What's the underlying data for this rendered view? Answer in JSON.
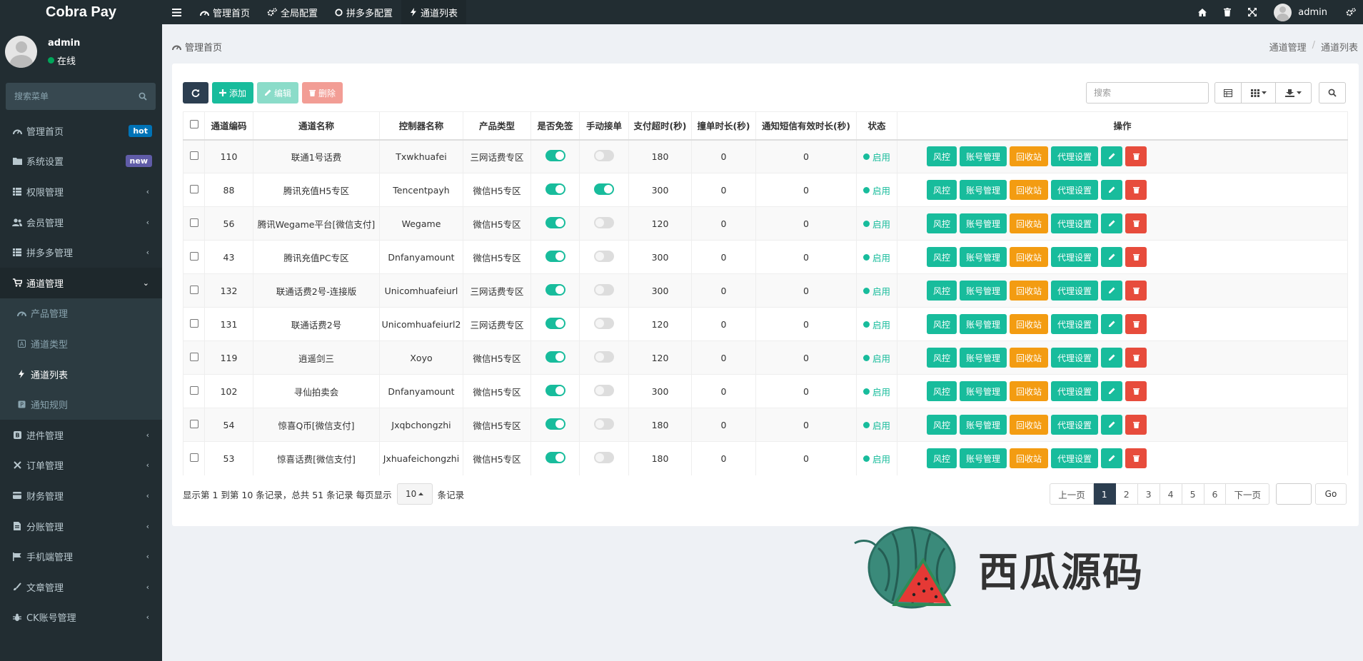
{
  "app": {
    "brand": "Cobra Pay"
  },
  "user": {
    "name": "admin",
    "status": "在线"
  },
  "sidebar": {
    "search_placeholder": "搜索菜单",
    "items": [
      {
        "label": "管理首页",
        "badge": "hot",
        "badge_color": "#0073b7"
      },
      {
        "label": "系统设置",
        "badge": "new",
        "badge_color": "#605ca8"
      },
      {
        "label": "权限管理"
      },
      {
        "label": "会员管理"
      },
      {
        "label": "拼多多管理"
      },
      {
        "label": "通道管理"
      }
    ],
    "sub_items": [
      {
        "label": "产品管理"
      },
      {
        "label": "通道类型"
      },
      {
        "label": "通道列表"
      },
      {
        "label": "通知规则"
      }
    ],
    "items_after": [
      {
        "label": "进件管理"
      },
      {
        "label": "订单管理"
      },
      {
        "label": "财务管理"
      },
      {
        "label": "分账管理"
      },
      {
        "label": "手机端管理"
      },
      {
        "label": "文章管理"
      },
      {
        "label": "CK账号管理"
      }
    ]
  },
  "topnav": {
    "tabs": [
      {
        "label": "管理首页"
      },
      {
        "label": "全局配置"
      },
      {
        "label": "拼多多配置"
      },
      {
        "label": "通道列表"
      }
    ],
    "right_user": "admin"
  },
  "content": {
    "title": "管理首页",
    "breadcrumb": [
      "通道管理",
      "通道列表"
    ]
  },
  "toolbar": {
    "add": "添加",
    "edit": "编辑",
    "delete": "删除",
    "search_placeholder": "搜索"
  },
  "table": {
    "columns": [
      "通道编码",
      "通道名称",
      "控制器名称",
      "产品类型",
      "是否免签",
      "手动接单",
      "支付超时(秒)",
      "撞单时长(秒)",
      "通知短信有效时长(秒)",
      "状态",
      "操作"
    ],
    "rows": [
      {
        "code": "110",
        "name": "联通1号话费",
        "controller": "Txwkhuafei",
        "product": "三网话费专区",
        "free_sign": true,
        "manual": false,
        "timeout": "180",
        "collide": "0",
        "sms": "0",
        "status": "启用"
      },
      {
        "code": "88",
        "name": "腾讯充值H5专区",
        "controller": "Tencentpayh",
        "product": "微信H5专区",
        "free_sign": true,
        "manual": true,
        "timeout": "300",
        "collide": "0",
        "sms": "0",
        "status": "启用"
      },
      {
        "code": "56",
        "name": "腾讯Wegame平台[微信支付]",
        "controller": "Wegame",
        "product": "微信H5专区",
        "free_sign": true,
        "manual": false,
        "timeout": "120",
        "collide": "0",
        "sms": "0",
        "status": "启用"
      },
      {
        "code": "43",
        "name": "腾讯充值PC专区",
        "controller": "Dnfanyamount",
        "product": "微信H5专区",
        "free_sign": true,
        "manual": false,
        "timeout": "300",
        "collide": "0",
        "sms": "0",
        "status": "启用"
      },
      {
        "code": "132",
        "name": "联通话费2号-连接版",
        "controller": "Unicomhuafeiurl",
        "product": "三网话费专区",
        "free_sign": true,
        "manual": false,
        "timeout": "300",
        "collide": "0",
        "sms": "0",
        "status": "启用"
      },
      {
        "code": "131",
        "name": "联通话费2号",
        "controller": "Unicomhuafeiurl2",
        "product": "三网话费专区",
        "free_sign": true,
        "manual": false,
        "timeout": "120",
        "collide": "0",
        "sms": "0",
        "status": "启用"
      },
      {
        "code": "119",
        "name": "逍遥剑三",
        "controller": "Xoyo",
        "product": "微信H5专区",
        "free_sign": true,
        "manual": false,
        "timeout": "120",
        "collide": "0",
        "sms": "0",
        "status": "启用"
      },
      {
        "code": "102",
        "name": "寻仙拍卖会",
        "controller": "Dnfanyamount",
        "product": "微信H5专区",
        "free_sign": true,
        "manual": false,
        "timeout": "300",
        "collide": "0",
        "sms": "0",
        "status": "启用"
      },
      {
        "code": "54",
        "name": "惊喜Q币[微信支付]",
        "controller": "Jxqbchongzhi",
        "product": "微信H5专区",
        "free_sign": true,
        "manual": false,
        "timeout": "180",
        "collide": "0",
        "sms": "0",
        "status": "启用"
      },
      {
        "code": "53",
        "name": "惊喜话费[微信支付]",
        "controller": "Jxhuafeichongzhi",
        "product": "微信H5专区",
        "free_sign": true,
        "manual": false,
        "timeout": "180",
        "collide": "0",
        "sms": "0",
        "status": "启用"
      }
    ],
    "ops": {
      "risk": "风控",
      "account": "账号管理",
      "recycle": "回收站",
      "agent": "代理设置"
    }
  },
  "footer": {
    "info_prefix": "显示第 1 到第 10 条记录，总共 51 条记录 每页显示",
    "page_size": "10",
    "info_suffix": "条记录",
    "prev": "上一页",
    "pages": [
      "1",
      "2",
      "3",
      "4",
      "5",
      "6"
    ],
    "current_page": "1",
    "next": "下一页",
    "go": "Go"
  },
  "watermark": {
    "text": "西瓜源码"
  },
  "colors": {
    "primary": "#18bc9c",
    "warning": "#f39c12",
    "danger": "#e74c3c",
    "dark": "#2c3e50",
    "sidebar": "#222d32"
  }
}
